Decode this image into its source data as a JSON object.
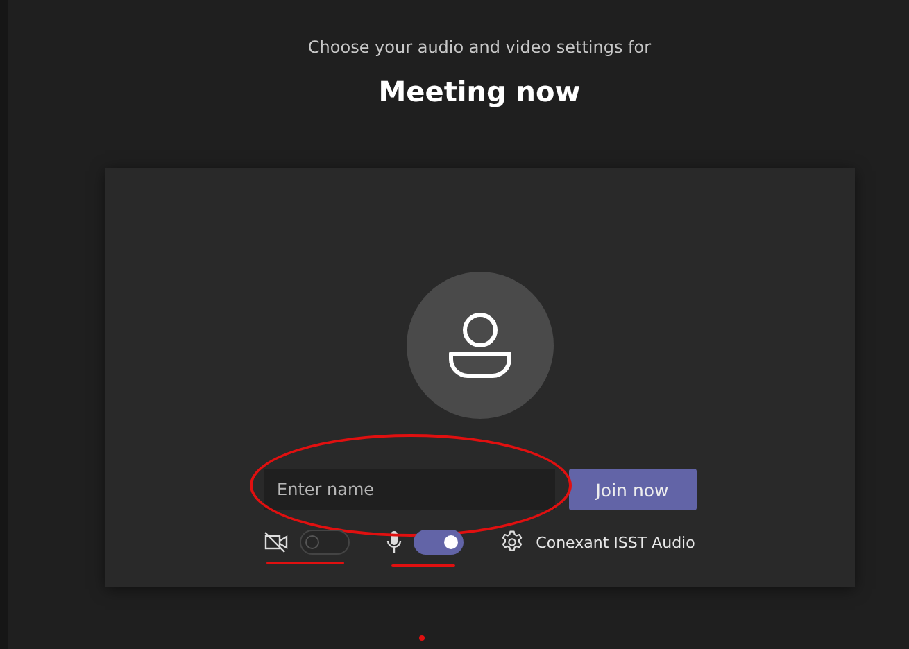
{
  "subtitle": "Choose your audio and video settings for",
  "title": "Meeting now",
  "name_field": {
    "placeholder": "Enter name",
    "circled": true
  },
  "join_button": {
    "label": "Join now"
  },
  "controls": [
    {
      "kind": "camera",
      "on": false,
      "underlined": true
    },
    {
      "kind": "mic",
      "on": true,
      "underlined": true
    },
    {
      "kind": "device",
      "label": "Conexant ISST Audio"
    }
  ],
  "marker_dot": true
}
